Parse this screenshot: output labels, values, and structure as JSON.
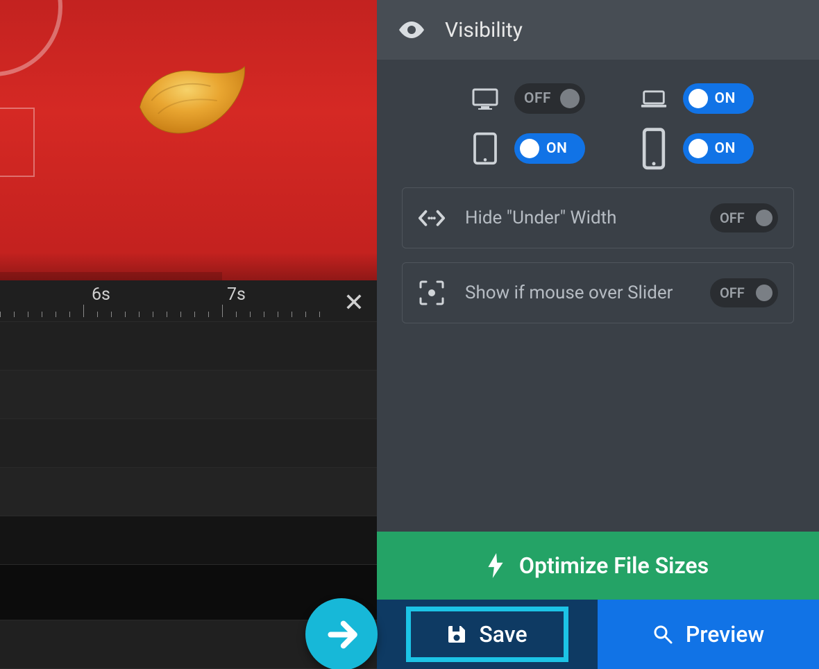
{
  "panel": {
    "section_title": "Visibility"
  },
  "timeline": {
    "label_6s": "6s",
    "label_7s": "7s"
  },
  "toggles": {
    "on_label": "ON",
    "off_label": "OFF"
  },
  "visibility": {
    "desktop": {
      "state": "OFF"
    },
    "laptop": {
      "state": "ON"
    },
    "tablet": {
      "state": "ON"
    },
    "phone": {
      "state": "ON"
    }
  },
  "options": {
    "hide_under_width": {
      "label": "Hide \"Under\" Width",
      "state": "OFF"
    },
    "show_if_mouse_over": {
      "label": "Show if mouse over Slider",
      "state": "OFF"
    }
  },
  "footer": {
    "optimize_label": "Optimize File Sizes",
    "save_label": "Save",
    "preview_label": "Preview"
  },
  "colors": {
    "accent_blue": "#1173e6",
    "accent_cyan": "#1cc4e6",
    "optimize_green": "#24a366",
    "panel_bg": "#3a4047",
    "canvas_red": "#d6231e"
  }
}
